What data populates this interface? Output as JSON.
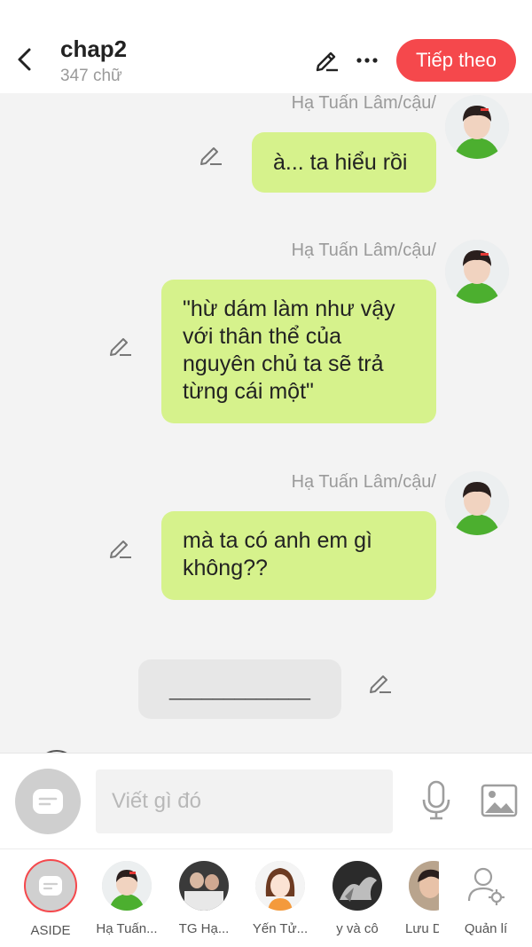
{
  "header": {
    "title": "chap2",
    "word_count": "347 chữ",
    "next_label": "Tiếp theo",
    "back_icon": "chevron-left-icon",
    "edit_icon": "pencil-icon",
    "more_icon": "more-horizontal-icon"
  },
  "messages": [
    {
      "sender": "Hạ Tuấn Lâm/cậu/",
      "lines": [
        "à... ta hiểu rồi"
      ]
    },
    {
      "sender": "Hạ Tuấn Lâm/cậu/",
      "lines": [
        "\"hừ dám làm như vậy",
        "với thân thể của",
        "nguyên chủ ta sẽ trả",
        "từng cái một\""
      ]
    },
    {
      "sender": "Hạ Tuấn Lâm/cậu/",
      "lines": [
        "mà ta có anh em gì",
        "không??"
      ]
    }
  ],
  "narration": {
    "text": "_____________"
  },
  "input": {
    "placeholder": "Viết gì đó",
    "mic_icon": "microphone-icon",
    "image_icon": "image-icon"
  },
  "characters": [
    {
      "label": "ASIDE"
    },
    {
      "label": "Hạ Tuấn..."
    },
    {
      "label": "TG Hạ..."
    },
    {
      "label": "Yến Tử..."
    },
    {
      "label": "y và cô"
    },
    {
      "label": "Lưu D"
    },
    {
      "label": "Quản lí"
    }
  ],
  "colors": {
    "accent": "#f5484c",
    "bubble": "#d6f28c",
    "background": "#f3f3f3"
  }
}
